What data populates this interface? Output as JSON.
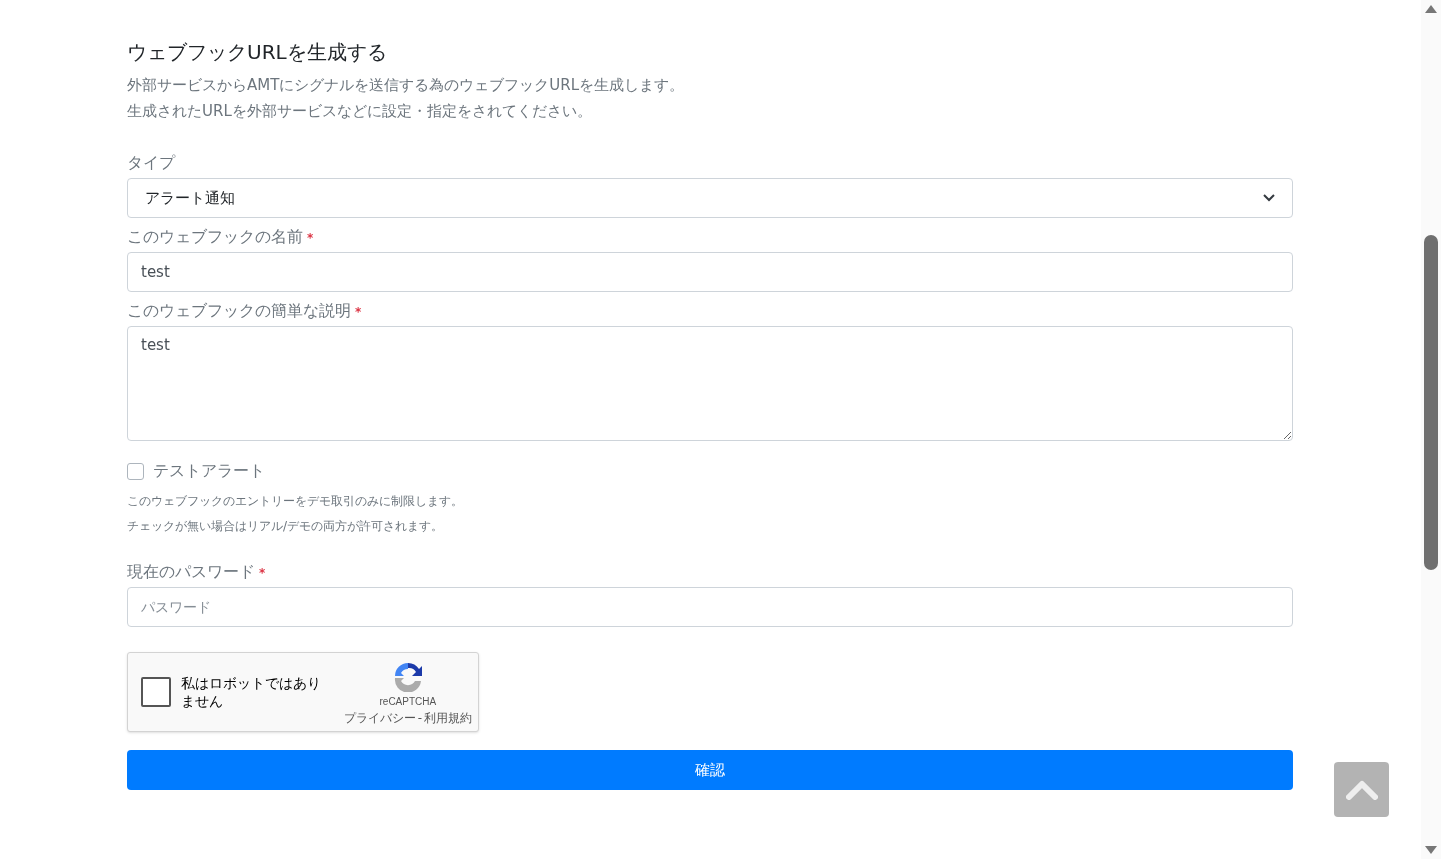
{
  "heading": "ウェブフックURLを生成する",
  "description": [
    "外部サービスからAMTにシグナルを送信する為のウェブフックURLを生成します。",
    "生成されたURLを外部サービスなどに設定・指定をされてください。"
  ],
  "type_field": {
    "label": "タイプ",
    "value": "アラート通知"
  },
  "name_field": {
    "label": "このウェブフックの名前",
    "required_mark": "*",
    "value": "test"
  },
  "description_field": {
    "label": "このウェブフックの簡単な説明",
    "required_mark": "*",
    "value": "test"
  },
  "test_alert": {
    "label": "テストアラート",
    "checked": false,
    "help": [
      "このウェブフックのエントリーをデモ取引のみに制限します。",
      "チェックが無い場合はリアル/デモの両方が許可されます。"
    ]
  },
  "password_field": {
    "label": "現在のパスワード",
    "required_mark": "*",
    "placeholder": "パスワード"
  },
  "recaptcha": {
    "label": "私はロボットではありません",
    "checked": false,
    "brand": "reCAPTCHA",
    "privacy": "プライバシー",
    "separator": "-",
    "terms": "利用規約"
  },
  "submit": "確認"
}
